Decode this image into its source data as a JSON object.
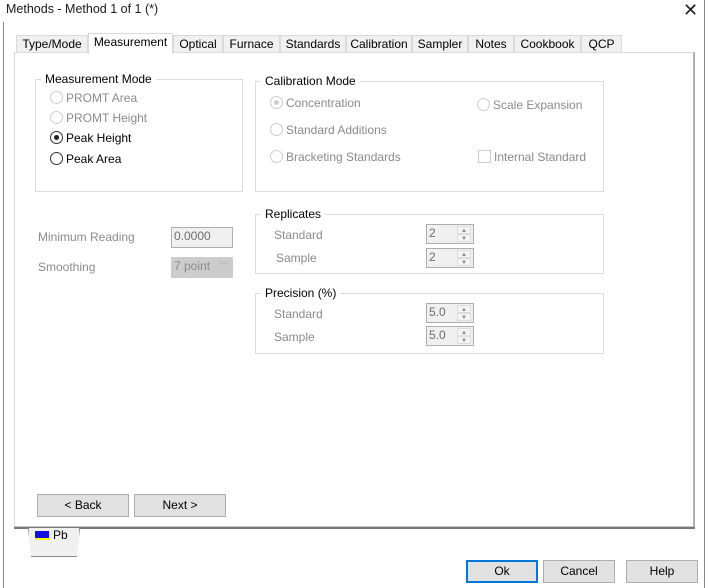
{
  "window": {
    "title": "Methods - Method 1 of 1 (*)",
    "close_icon": "close-icon"
  },
  "tabs": [
    {
      "label": "Type/Mode"
    },
    {
      "label": "Measurement",
      "active": true
    },
    {
      "label": "Optical"
    },
    {
      "label": "Furnace"
    },
    {
      "label": "Standards"
    },
    {
      "label": "Calibration"
    },
    {
      "label": "Sampler"
    },
    {
      "label": "Notes"
    },
    {
      "label": "Cookbook"
    },
    {
      "label": "QCP"
    }
  ],
  "measurement_mode": {
    "title": "Measurement Mode",
    "options": [
      {
        "label": "PROMT Area",
        "enabled": false
      },
      {
        "label": "PROMT Height",
        "enabled": false
      },
      {
        "label": "Peak Height",
        "enabled": true,
        "selected": true
      },
      {
        "label": "Peak Area",
        "enabled": true
      }
    ]
  },
  "calibration_mode": {
    "title": "Calibration Mode",
    "options": [
      {
        "label": "Concentration",
        "selected": true
      },
      {
        "label": "Standard Additions"
      },
      {
        "label": "Bracketing Standards"
      },
      {
        "label": "Scale Expansion"
      }
    ],
    "internal_standard": {
      "label": "Internal Standard",
      "checked": false
    }
  },
  "minimum_reading": {
    "label": "Minimum Reading",
    "value": "0.0000"
  },
  "smoothing": {
    "label": "Smoothing",
    "value": "7 point"
  },
  "replicates": {
    "title": "Replicates",
    "standard_label": "Standard",
    "standard": "2",
    "sample_label": "Sample",
    "sample": "2"
  },
  "precision": {
    "title": "Precision (%)",
    "standard_label": "Standard",
    "standard": "5.0",
    "sample_label": "Sample",
    "sample": "5.0"
  },
  "nav": {
    "back": "< Back",
    "next": "Next >"
  },
  "element_tab": {
    "label": "Pb",
    "icon": "element-icon"
  },
  "footer": {
    "ok": "Ok",
    "cancel": "Cancel",
    "help": "Help"
  },
  "colors": {
    "accent": "#0078d7",
    "disabled_text": "#8a8a8a"
  }
}
